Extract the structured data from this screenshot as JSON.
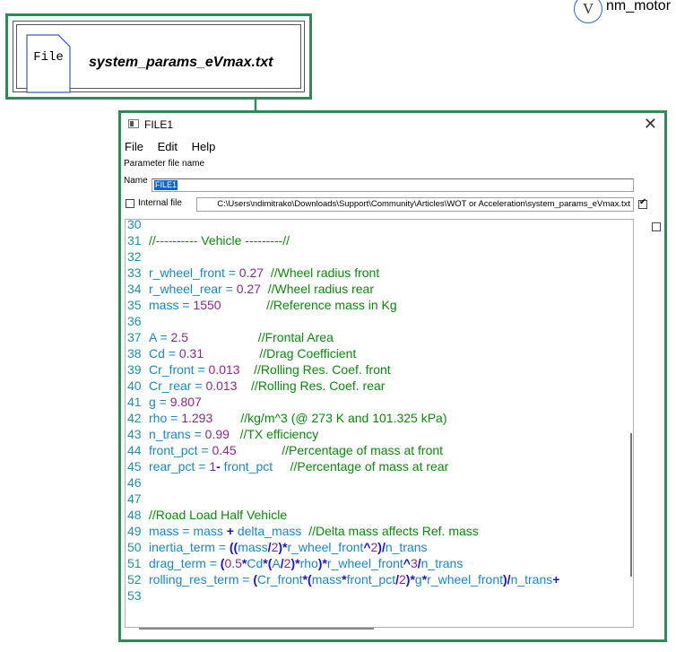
{
  "variable_node": {
    "letter": "V",
    "label": "nm_motor"
  },
  "file_block": {
    "icon_text": "File",
    "filename": "system_params_eVmax.txt"
  },
  "window": {
    "title": "FILE1",
    "close_glyph": "✕",
    "menu": [
      "File",
      "Edit",
      "Help"
    ],
    "section_label": "Parameter file name",
    "name_label": "Name",
    "name_value": "FILE1",
    "internal_file_label": "Internal file",
    "internal_file_checked": false,
    "path_value": "C:\\Users\\ndimitrako\\Downloads\\Support\\Community\\Articles\\WOT or Acceleration\\system_params_eVmax.txt",
    "path_checked": true,
    "side_checked": false
  },
  "code_lines": [
    {
      "n": "30",
      "tokens": []
    },
    {
      "n": "31",
      "tokens": [
        [
          "cmt",
          "//---------- Vehicle ---------//"
        ]
      ]
    },
    {
      "n": "32",
      "tokens": []
    },
    {
      "n": "33",
      "tokens": [
        [
          "ident",
          "r_wheel_front"
        ],
        [
          "plain",
          " = "
        ],
        [
          "num",
          "0.27"
        ],
        [
          "cmt",
          "  //Wheel radius front"
        ]
      ]
    },
    {
      "n": "34",
      "tokens": [
        [
          "ident",
          "r_wheel_rear"
        ],
        [
          "plain",
          " = "
        ],
        [
          "num",
          "0.27"
        ],
        [
          "cmt",
          "  //Wheel radius rear"
        ]
      ]
    },
    {
      "n": "35",
      "tokens": [
        [
          "ident",
          "mass"
        ],
        [
          "plain",
          " = "
        ],
        [
          "num",
          "1550"
        ],
        [
          "cmt",
          "             //Reference mass in Kg"
        ]
      ]
    },
    {
      "n": "36",
      "tokens": []
    },
    {
      "n": "37",
      "tokens": [
        [
          "ident",
          "A"
        ],
        [
          "plain",
          " = "
        ],
        [
          "num",
          "2.5"
        ],
        [
          "cmt",
          "                    //Frontal Area"
        ]
      ]
    },
    {
      "n": "38",
      "tokens": [
        [
          "ident",
          "Cd"
        ],
        [
          "plain",
          " = "
        ],
        [
          "num",
          "0.31"
        ],
        [
          "cmt",
          "                //Drag Coefficient"
        ]
      ]
    },
    {
      "n": "39",
      "tokens": [
        [
          "ident",
          "Cr_front"
        ],
        [
          "plain",
          " = "
        ],
        [
          "num",
          "0.013"
        ],
        [
          "cmt",
          "    //Rolling Res. Coef. front"
        ]
      ]
    },
    {
      "n": "40",
      "tokens": [
        [
          "ident",
          "Cr_rear"
        ],
        [
          "plain",
          " = "
        ],
        [
          "num",
          "0.013"
        ],
        [
          "cmt",
          "    //Rolling Res. Coef. rear"
        ]
      ]
    },
    {
      "n": "41",
      "tokens": [
        [
          "ident",
          "g"
        ],
        [
          "plain",
          " = "
        ],
        [
          "num",
          "9.807"
        ]
      ]
    },
    {
      "n": "42",
      "tokens": [
        [
          "ident",
          "rho"
        ],
        [
          "plain",
          " = "
        ],
        [
          "num",
          "1.293"
        ],
        [
          "cmt",
          "        //kg/m^3 (@ 273 K and 101.325 kPa)"
        ]
      ]
    },
    {
      "n": "43",
      "tokens": [
        [
          "ident",
          "n_trans"
        ],
        [
          "plain",
          " = "
        ],
        [
          "num",
          "0.99"
        ],
        [
          "cmt",
          "   //TX efficiency"
        ]
      ]
    },
    {
      "n": "44",
      "tokens": [
        [
          "ident",
          "front_pct"
        ],
        [
          "plain",
          " = "
        ],
        [
          "num",
          "0.45"
        ],
        [
          "cmt",
          "             //Percentage of mass at front"
        ]
      ]
    },
    {
      "n": "45",
      "tokens": [
        [
          "ident",
          "rear_pct"
        ],
        [
          "plain",
          " = "
        ],
        [
          "num",
          "1"
        ],
        [
          "op",
          "-"
        ],
        [
          "plain",
          " front_pct"
        ],
        [
          "cmt",
          "     //Percentage of mass at rear"
        ]
      ]
    },
    {
      "n": "46",
      "tokens": []
    },
    {
      "n": "47",
      "tokens": []
    },
    {
      "n": "48",
      "tokens": [
        [
          "cmt",
          "//Road Load Half Vehicle"
        ]
      ]
    },
    {
      "n": "49",
      "tokens": [
        [
          "ident",
          "mass"
        ],
        [
          "plain",
          " = mass "
        ],
        [
          "op",
          "+"
        ],
        [
          "plain",
          " delta_mass"
        ],
        [
          "cmt",
          "  //Delta mass affects Ref. mass"
        ]
      ]
    },
    {
      "n": "50",
      "tokens": [
        [
          "ident",
          "inertia_term"
        ],
        [
          "plain",
          " = "
        ],
        [
          "op",
          "(("
        ],
        [
          "plain",
          "mass"
        ],
        [
          "op",
          "/"
        ],
        [
          "num",
          "2"
        ],
        [
          "op",
          ")*"
        ],
        [
          "plain",
          "r_wheel_front"
        ],
        [
          "op",
          "^"
        ],
        [
          "num",
          "2"
        ],
        [
          "op",
          ")/"
        ],
        [
          "plain",
          "n_trans"
        ]
      ]
    },
    {
      "n": "51",
      "tokens": [
        [
          "ident",
          "drag_term"
        ],
        [
          "plain",
          " = "
        ],
        [
          "op",
          "("
        ],
        [
          "num",
          "0.5"
        ],
        [
          "op",
          "*"
        ],
        [
          "plain",
          "Cd"
        ],
        [
          "op",
          "*("
        ],
        [
          "plain",
          "A"
        ],
        [
          "op",
          "/"
        ],
        [
          "num",
          "2"
        ],
        [
          "op",
          ")*"
        ],
        [
          "plain",
          "rho"
        ],
        [
          "op",
          ")*"
        ],
        [
          "plain",
          "r_wheel_front"
        ],
        [
          "op",
          "^"
        ],
        [
          "num",
          "3"
        ],
        [
          "op",
          "/"
        ],
        [
          "plain",
          "n_trans"
        ]
      ]
    },
    {
      "n": "52",
      "tokens": [
        [
          "ident",
          "rolling_res_term"
        ],
        [
          "plain",
          " = "
        ],
        [
          "op",
          "("
        ],
        [
          "plain",
          "Cr_front"
        ],
        [
          "op",
          "*("
        ],
        [
          "plain",
          "mass"
        ],
        [
          "op",
          "*"
        ],
        [
          "plain",
          "front_pct"
        ],
        [
          "op",
          "/"
        ],
        [
          "num",
          "2"
        ],
        [
          "op",
          ")*"
        ],
        [
          "plain",
          "g"
        ],
        [
          "op",
          "*"
        ],
        [
          "plain",
          "r_wheel_front"
        ],
        [
          "op",
          ")/"
        ],
        [
          "plain",
          "n_trans"
        ],
        [
          "op",
          "+"
        ]
      ]
    },
    {
      "n": "53",
      "tokens": []
    }
  ]
}
